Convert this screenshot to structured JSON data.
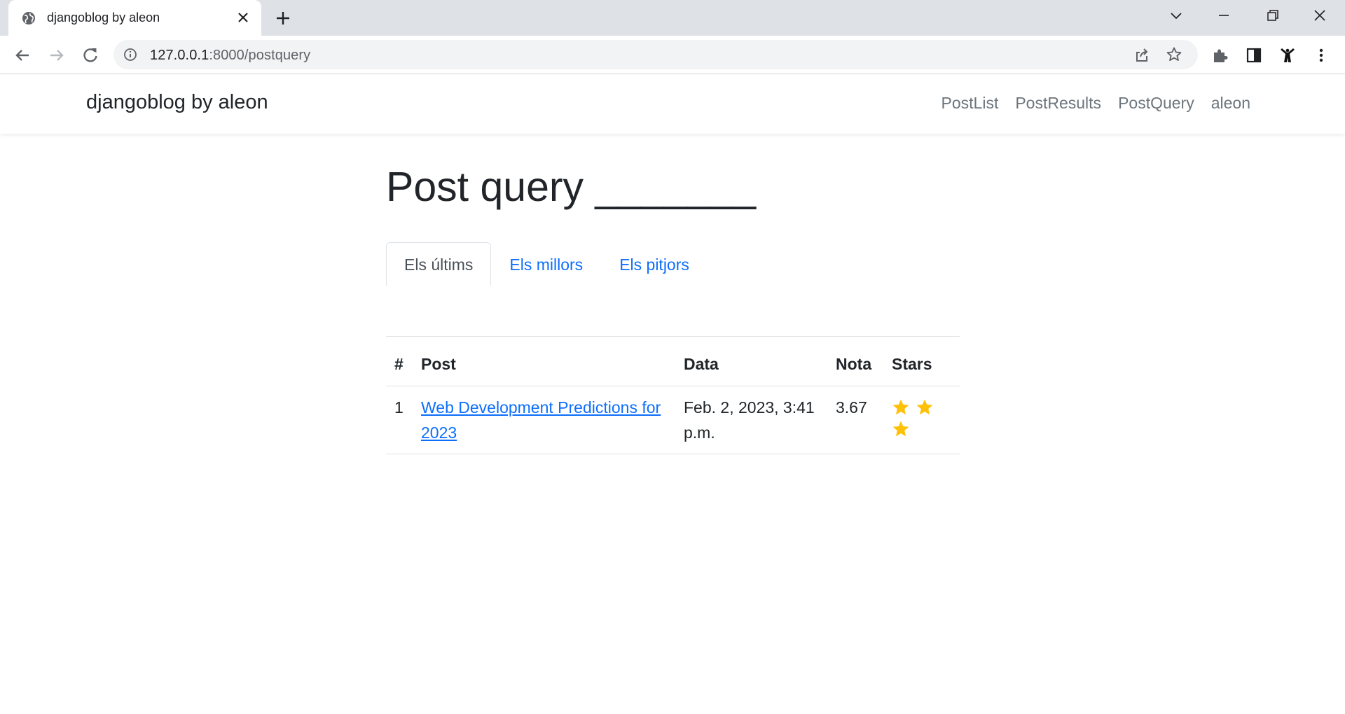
{
  "browser": {
    "tab_title": "djangoblog by aleon",
    "url_host": "127.0.0.1",
    "url_rest": ":8000/postquery"
  },
  "site": {
    "brand": "djangoblog by aleon",
    "nav": [
      "PostList",
      "PostResults",
      "PostQuery",
      "aleon"
    ]
  },
  "page": {
    "title": "Post query _______",
    "tabs": [
      "Els últims",
      "Els millors",
      "Els pitjors"
    ],
    "active_tab": "Els últims"
  },
  "table": {
    "headers": [
      "#",
      "Post",
      "Data",
      "Nota",
      "Stars"
    ],
    "rows": [
      {
        "num": "1",
        "post": "Web Development Predictions for 2023",
        "date": "Feb. 2, 2023, 3:41 p.m.",
        "nota": "3.67",
        "stars": 3
      }
    ]
  },
  "colors": {
    "link": "#0d6efd",
    "star": "#ffc107"
  }
}
